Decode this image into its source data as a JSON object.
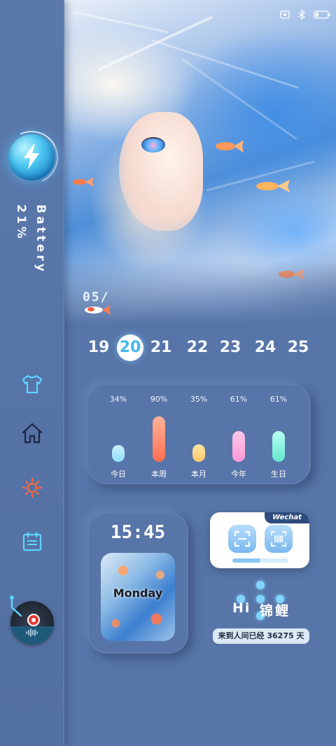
{
  "battery": {
    "label": "Battery",
    "value": "21%",
    "level": 21
  },
  "nav": [
    {
      "name": "tshirt-icon"
    },
    {
      "name": "home-icon"
    },
    {
      "name": "sun-icon"
    },
    {
      "name": "calendar-icon"
    }
  ],
  "music": {
    "icon": "netease-music-icon"
  },
  "hero": {
    "date_label": "05/"
  },
  "dates": [
    "19",
    "20",
    "21",
    "22",
    "23",
    "24",
    "25"
  ],
  "active_date": "20",
  "stats": [
    {
      "pct": "34%",
      "label": "今日",
      "value": 34,
      "color_top": "#c8f0ff",
      "color_bottom": "#8ee0ff"
    },
    {
      "pct": "90%",
      "label": "本周",
      "value": 90,
      "color_top": "#ffb39a",
      "color_bottom": "#ff6f4e"
    },
    {
      "pct": "35%",
      "label": "本月",
      "value": 35,
      "color_top": "#ffe6a6",
      "color_bottom": "#ffc86a"
    },
    {
      "pct": "61%",
      "label": "今年",
      "value": 61,
      "color_top": "#ffc8ea",
      "color_bottom": "#ff98d6"
    },
    {
      "pct": "61%",
      "label": "生日",
      "value": 61,
      "color_top": "#b9fff0",
      "color_bottom": "#62e6d0"
    }
  ],
  "clock": {
    "time": "15:45",
    "day": "Monday"
  },
  "wechat": {
    "tag": "Wechat",
    "buttons": [
      "scan-icon",
      "barcode-icon"
    ],
    "progress": 0.5
  },
  "greeting": {
    "hi": "Hi",
    "name": "锦鲤",
    "days_text": "来到人间已经  36275  天"
  },
  "colors": {
    "background": "#5775a8",
    "accent": "#46b6ec",
    "icon": "#5ed4ff"
  }
}
